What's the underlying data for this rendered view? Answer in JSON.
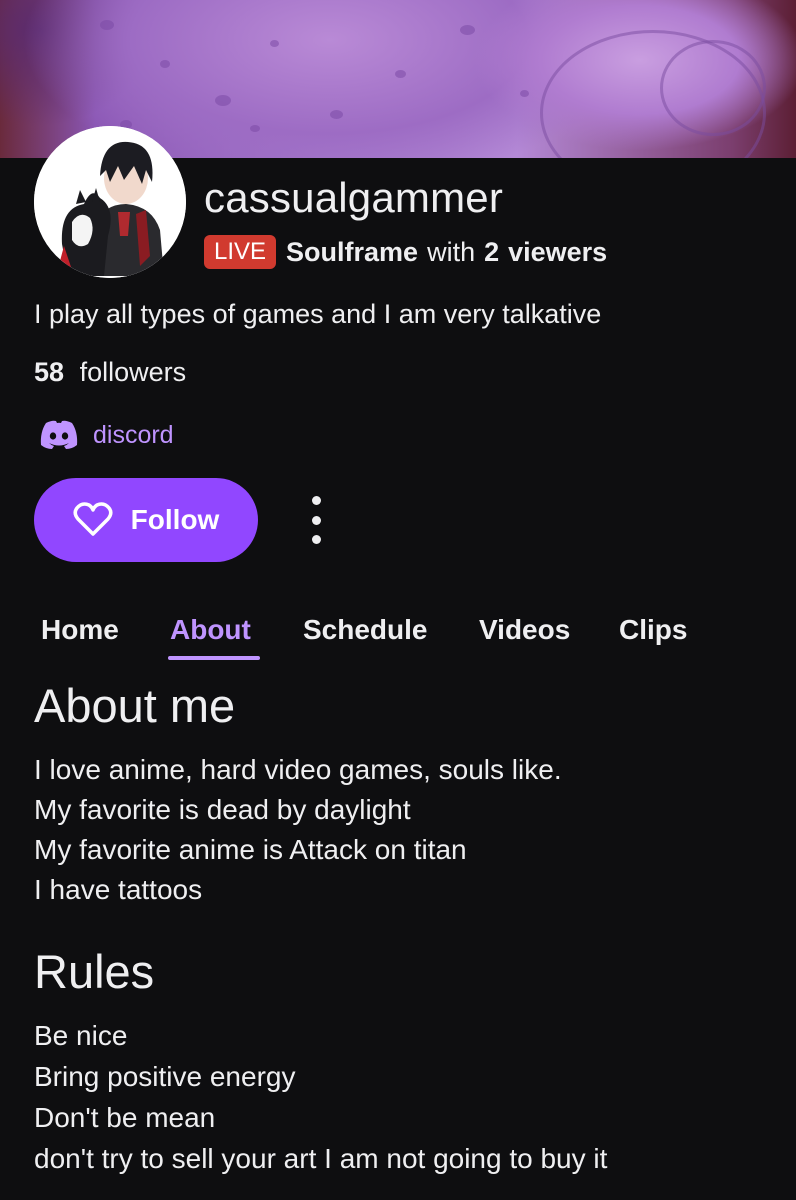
{
  "channel": {
    "username": "cassualgammer",
    "live_badge": "LIVE",
    "game": "Soulframe",
    "with_text": "with",
    "viewer_count": "2",
    "viewers_word": "viewers",
    "bio": "I play all types of games and I am very talkative",
    "followers_count": "58",
    "followers_word": "followers",
    "social_link": {
      "label": "discord",
      "icon": "discord-icon"
    },
    "follow_button": {
      "label": "Follow",
      "icon": "heart-outline-icon"
    },
    "more_menu_icon": "vertical-ellipsis-icon"
  },
  "tabs": [
    {
      "label": "Home",
      "active": false
    },
    {
      "label": "About",
      "active": true
    },
    {
      "label": "Schedule",
      "active": false
    },
    {
      "label": "Videos",
      "active": false
    },
    {
      "label": "Clips",
      "active": false
    }
  ],
  "about": {
    "heading": "About me",
    "lines": [
      "I love anime, hard video games, souls like.",
      "My favorite is dead by daylight",
      "My favorite anime is Attack on titan",
      "I have tattoos"
    ]
  },
  "rules": {
    "heading": "Rules",
    "lines": [
      "Be nice",
      "Bring positive energy",
      "Don't be mean",
      "don't try to sell your art I am not going to buy it"
    ]
  },
  "colors": {
    "background": "#0e0e10",
    "accent": "#9147ff",
    "accent_text": "#bf94ff",
    "live_red": "#d13a2f"
  }
}
